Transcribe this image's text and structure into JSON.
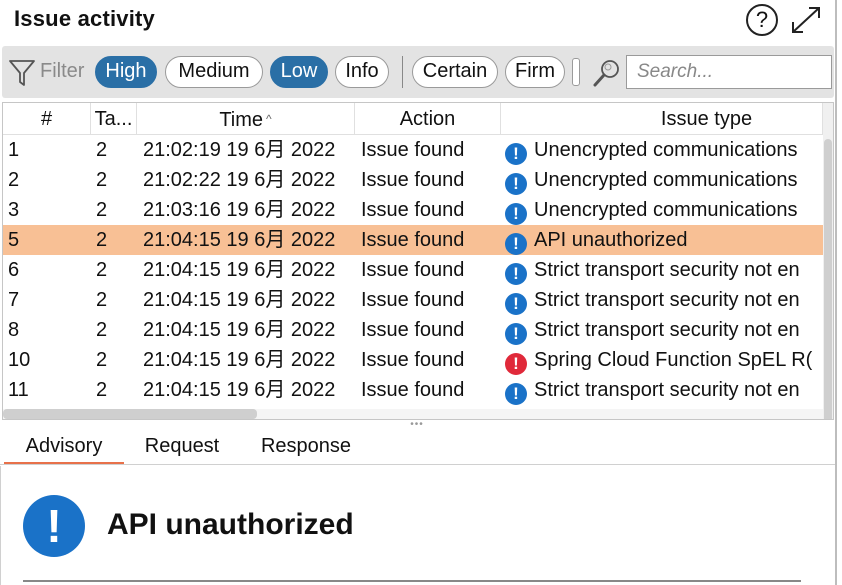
{
  "header": {
    "title": "Issue activity",
    "help_glyph": "?",
    "icons": [
      "help-icon",
      "expand-icon"
    ]
  },
  "filter": {
    "label": "Filter",
    "severity": [
      {
        "label": "High",
        "active": true
      },
      {
        "label": "Medium",
        "active": false
      },
      {
        "label": "Low",
        "active": true
      },
      {
        "label": "Info",
        "active": false
      }
    ],
    "confidence": [
      {
        "label": "Certain",
        "active": false
      },
      {
        "label": "Firm",
        "active": false
      }
    ],
    "search_placeholder": "Search..."
  },
  "table": {
    "columns": [
      "#",
      "Ta...",
      "Time",
      "Action",
      "Issue type"
    ],
    "sort_column": "Time",
    "sort_direction": "ascending",
    "rows": [
      {
        "num": "1",
        "task": "2",
        "time": "21:02:19 19 6月 2022",
        "action": "Issue found",
        "type": "Unencrypted communications",
        "severity": "info",
        "selected": false
      },
      {
        "num": "2",
        "task": "2",
        "time": "21:02:22 19 6月 2022",
        "action": "Issue found",
        "type": "Unencrypted communications",
        "severity": "info",
        "selected": false
      },
      {
        "num": "3",
        "task": "2",
        "time": "21:03:16 19 6月 2022",
        "action": "Issue found",
        "type": "Unencrypted communications",
        "severity": "info",
        "selected": false
      },
      {
        "num": "5",
        "task": "2",
        "time": "21:04:15 19 6月 2022",
        "action": "Issue found",
        "type": "API unauthorized",
        "severity": "info",
        "selected": true
      },
      {
        "num": "6",
        "task": "2",
        "time": "21:04:15 19 6月 2022",
        "action": "Issue found",
        "type": "Strict transport security not en",
        "severity": "info",
        "selected": false
      },
      {
        "num": "7",
        "task": "2",
        "time": "21:04:15 19 6月 2022",
        "action": "Issue found",
        "type": "Strict transport security not en",
        "severity": "info",
        "selected": false
      },
      {
        "num": "8",
        "task": "2",
        "time": "21:04:15 19 6月 2022",
        "action": "Issue found",
        "type": "Strict transport security not en",
        "severity": "info",
        "selected": false
      },
      {
        "num": "10",
        "task": "2",
        "time": "21:04:15 19 6月 2022",
        "action": "Issue found",
        "type": "Spring Cloud Function SpEL R(",
        "severity": "high",
        "selected": false
      },
      {
        "num": "11",
        "task": "2",
        "time": "21:04:15 19 6月 2022",
        "action": "Issue found",
        "type": "Strict transport security not en",
        "severity": "info",
        "selected": false
      }
    ]
  },
  "tabs": [
    {
      "label": "Advisory",
      "active": true
    },
    {
      "label": "Request",
      "active": false
    },
    {
      "label": "Response",
      "active": false
    }
  ],
  "advisory": {
    "title": "API unauthorized",
    "severity_glyph": "!"
  },
  "colors": {
    "pill_active": "#2a6fa6",
    "selected_row": "#f8c095",
    "info_icon": "#1a72c8",
    "high_icon": "#e0293a",
    "active_tab_underline": "#e8714a"
  }
}
